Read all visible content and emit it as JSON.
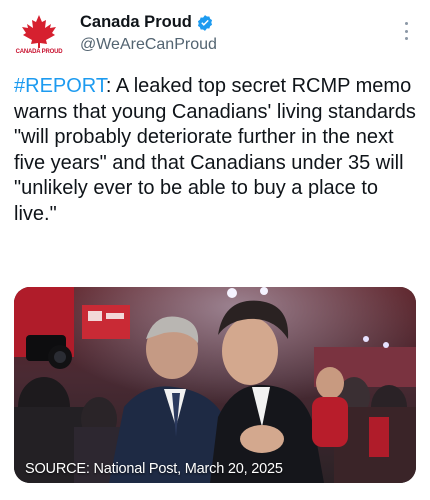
{
  "author": {
    "display_name": "Canada Proud",
    "handle": "@WeAreCanProud",
    "avatar_text": "CANADA PROUD",
    "verified": true
  },
  "tweet": {
    "hashtag": "#REPORT",
    "body": ": A leaked top secret RCMP memo warns that young Canadians' living standards \"will probably deteriorate further in the next five years\" and that Canadians under 35 will \"unlikely ever to be able to buy a place to live.\""
  },
  "media": {
    "caption": "SOURCE: National Post, March 20, 2025"
  },
  "colors": {
    "accent": "#1d9bf0",
    "text": "#0f1419",
    "secondary": "#536471",
    "brand_red": "#c8102e"
  },
  "icons": {
    "verified": "verified-badge-icon",
    "more": "more-options-icon",
    "avatar": "maple-leaf-icon"
  }
}
